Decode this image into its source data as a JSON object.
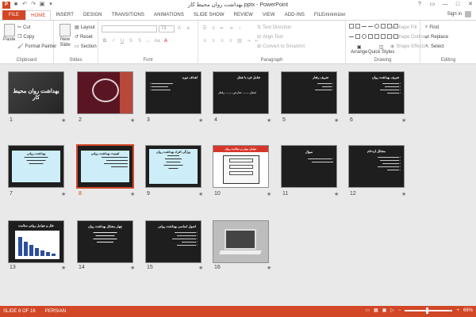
{
  "window": {
    "title": "بهداشت روان محیط کار.pptx - PowerPoint",
    "app_icon": "P",
    "controls": [
      "?",
      "▭",
      "—",
      "□",
      "✕"
    ]
  },
  "ribbon_tabs": [
    "FILE",
    "HOME",
    "INSERT",
    "DESIGN",
    "TRANSITIONS",
    "ANIMATIONS",
    "SLIDE SHOW",
    "REVIEW",
    "VIEW",
    "ADD-INS",
    "FILEminimizer"
  ],
  "active_tab": "HOME",
  "account": {
    "label": "Sign in"
  },
  "ribbon": {
    "clipboard": {
      "label": "Clipboard",
      "paste": "Paste",
      "cut": "Cut",
      "copy": "Copy",
      "format_painter": "Format Painter"
    },
    "slides": {
      "label": "Slides",
      "new_slide": "New Slide",
      "layout": "Layout",
      "reset": "Reset",
      "section": "Section"
    },
    "font": {
      "label": "Font",
      "size": "72"
    },
    "paragraph": {
      "label": "Paragraph",
      "text_direction": "Text Direction",
      "align_text": "Align Text",
      "convert_smartart": "Convert to SmartArt"
    },
    "drawing": {
      "label": "Drawing",
      "arrange": "Arrange",
      "quick_styles": "Quick Styles",
      "shape_fill": "Shape Fill",
      "shape_outline": "Shape Outline",
      "shape_effects": "Shape Effects"
    },
    "editing": {
      "label": "Editing",
      "find": "Find",
      "replace": "Replace",
      "select": "Select"
    }
  },
  "slides": [
    {
      "num": "1",
      "title": "بهداشت روان محیط کار"
    },
    {
      "num": "2",
      "title": ""
    },
    {
      "num": "3",
      "title": "اهداف دوره"
    },
    {
      "num": "4",
      "title": "تعامل فرد با شغل",
      "body": "شغل —— تعارض —— رفتار"
    },
    {
      "num": "5",
      "title": "تعریف رفتار"
    },
    {
      "num": "6",
      "title": "تعریف بهداشت روان"
    },
    {
      "num": "7",
      "title": "بهداشت روانی"
    },
    {
      "num": "8",
      "title": "اهمیت بهداشت روانی"
    },
    {
      "num": "9",
      "title": "ویژگی افراد بهداشت روان"
    },
    {
      "num": "10",
      "title": "عوامل موثر بر سلامت روان"
    },
    {
      "num": "11",
      "title": "سوال"
    },
    {
      "num": "12",
      "title": "مشکل ازدحام"
    },
    {
      "num": "13",
      "title": "علل و عوامل روانی سلامت"
    },
    {
      "num": "14",
      "title": "چهار مشکل بهداشت روان"
    },
    {
      "num": "15",
      "title": "اصول اساسی بهداشت روانی"
    },
    {
      "num": "16",
      "title": ""
    }
  ],
  "selected_slide": "8",
  "status": {
    "slide_info": "SLIDE 8 OF 16",
    "language": "PERSIAN",
    "zoom": "66%",
    "zoom_fraction": 0.47
  },
  "colors": {
    "accent": "#d24726",
    "panel": "#cdeef8",
    "slide_bg": "#1e1e1e"
  }
}
